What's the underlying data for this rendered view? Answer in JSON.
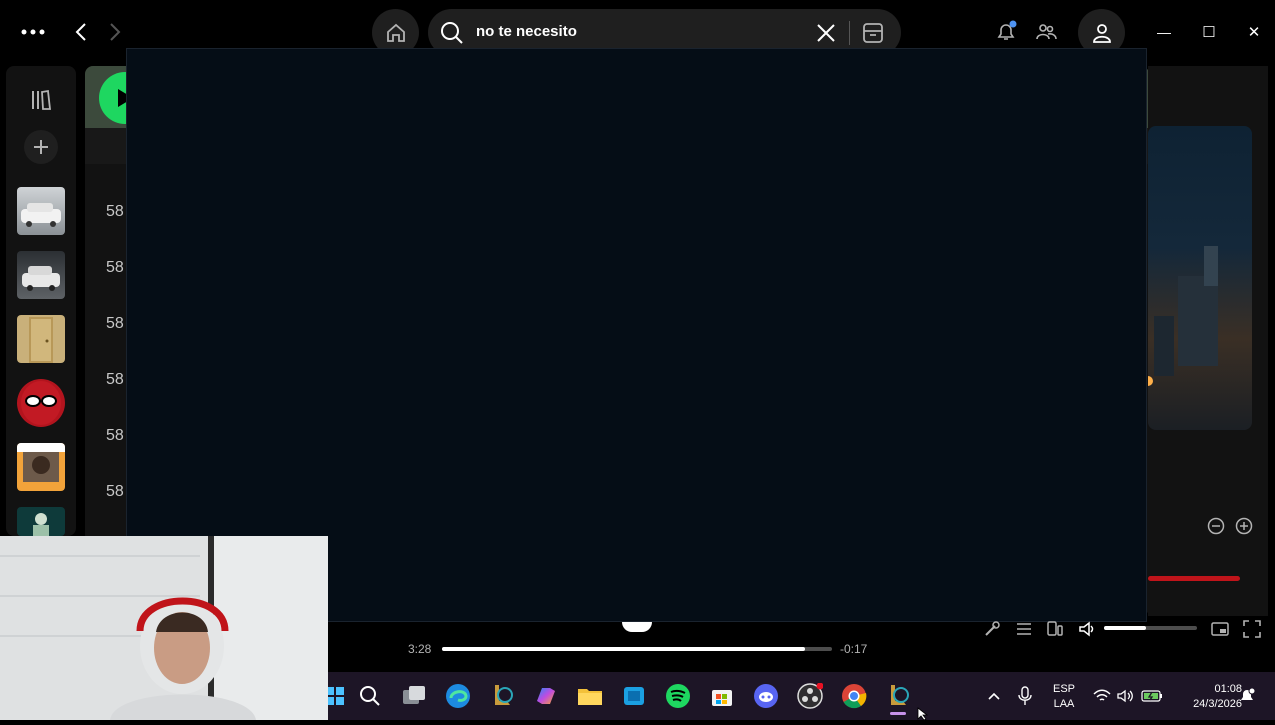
{
  "search": {
    "query": "no te necesito"
  },
  "window": {
    "minimize": "—",
    "maximize": "☐",
    "close": "✕"
  },
  "main": {
    "row_numbers": [
      "58",
      "58",
      "58",
      "58",
      "58",
      "58"
    ]
  },
  "player": {
    "elapsed": "3:28",
    "remaining": "-0:17",
    "progress_fraction": 0.93,
    "volume_fraction": 0.45
  },
  "taskbar": {
    "apps": [
      "start",
      "search",
      "task-view",
      "edge",
      "league-client",
      "copilot",
      "file-explorer",
      "store-blue",
      "spotify",
      "microsoft-store",
      "discord",
      "obs",
      "chrome",
      "league-of-legends"
    ],
    "lang_top": "ESP",
    "lang_bottom": "LAA",
    "time": "01:08",
    "date": "24/3/2026"
  },
  "colors": {
    "spotify_green": "#1ed760",
    "overlay": "#050d16",
    "taskbar": "#1d1526"
  }
}
